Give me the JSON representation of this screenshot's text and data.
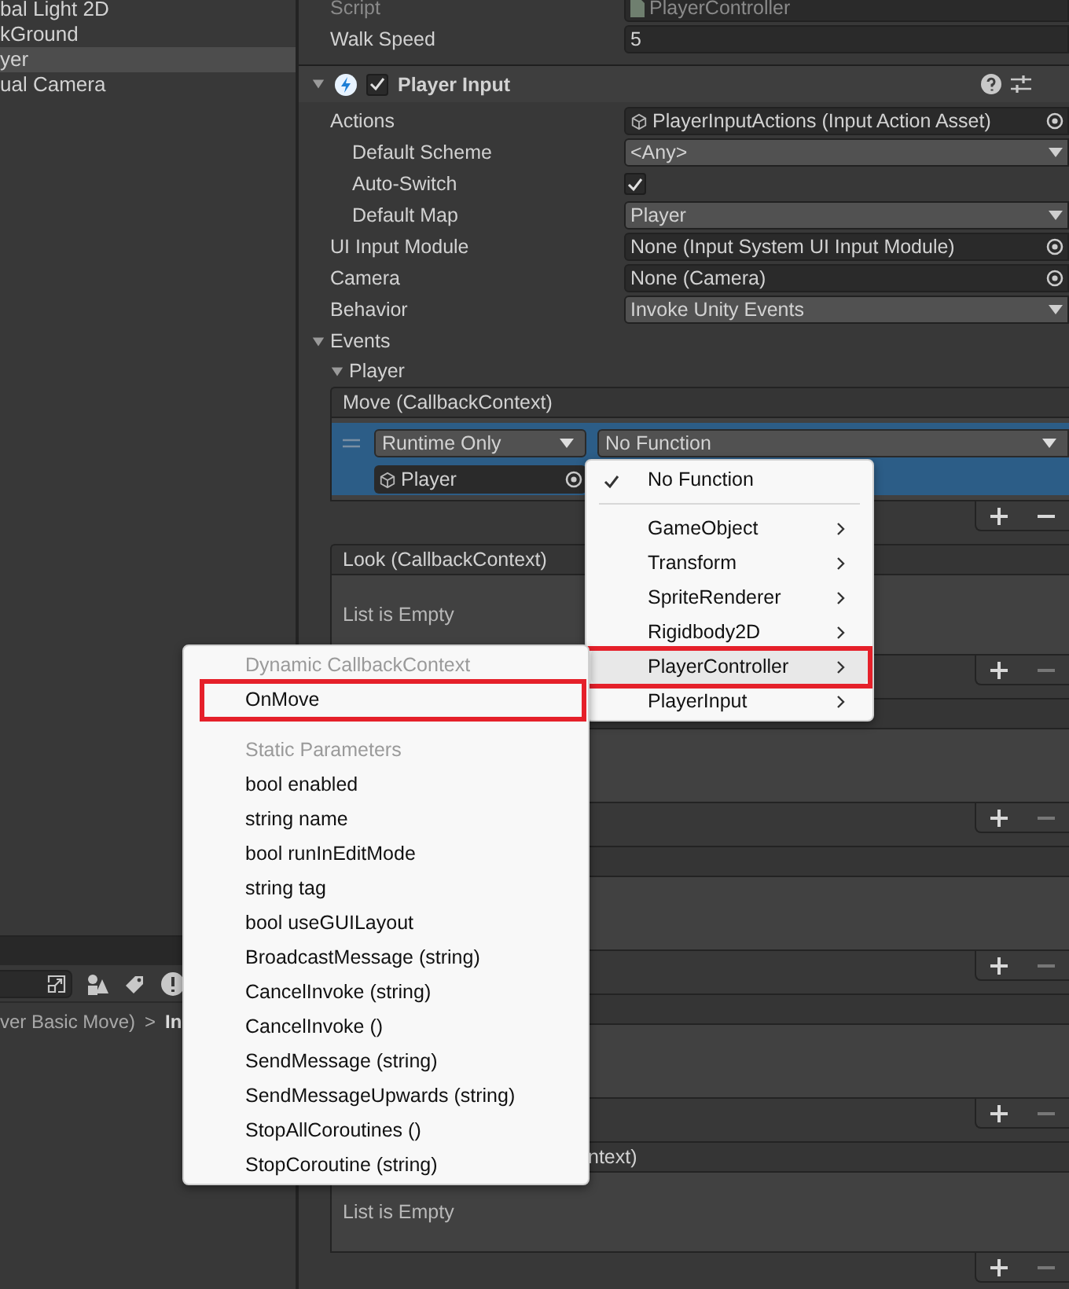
{
  "hierarchy": {
    "items": [
      {
        "label": "bal Light 2D",
        "selected": false
      },
      {
        "label": "kGround",
        "selected": false
      },
      {
        "label": "yer",
        "selected": true
      },
      {
        "label": "ual Camera",
        "selected": false
      }
    ]
  },
  "project": {
    "breadcrumb": [
      {
        "label": "ver Basic Move)",
        "current": false
      },
      {
        "label": "In",
        "current": true
      }
    ],
    "separator": ">"
  },
  "inspector": {
    "script": {
      "label": "Script",
      "value": "PlayerController",
      "disabled": true
    },
    "walk_speed": {
      "label": "Walk Speed",
      "value": "5"
    },
    "component": {
      "title": "Player Input",
      "enabled": true,
      "expanded": true,
      "properties": [
        {
          "label": "Actions",
          "kind": "object",
          "value": "PlayerInputActions (Input Action Asset)",
          "children": [
            {
              "label": "Default Scheme",
              "kind": "dropdown",
              "value": "<Any>"
            },
            {
              "label": "Auto-Switch",
              "kind": "checkbox",
              "checked": true
            },
            {
              "label": "Default Map",
              "kind": "dropdown",
              "value": "Player"
            }
          ]
        },
        {
          "label": "UI Input Module",
          "kind": "object",
          "value": "None (Input System UI Input Module)"
        },
        {
          "label": "Camera",
          "kind": "object",
          "value": "None (Camera)"
        },
        {
          "label": "Behavior",
          "kind": "dropdown",
          "value": "Invoke Unity Events"
        }
      ],
      "events": {
        "label": "Events",
        "expanded": true,
        "maps": [
          {
            "label": "Player",
            "expanded": true,
            "events": [
              {
                "header": "Move (CallbackContext)",
                "can_remove": true,
                "listeners": [
                  {
                    "runtime": "Runtime Only",
                    "function": "No Function",
                    "target": "Player",
                    "selected": true
                  }
                ]
              },
              {
                "header": "Look (CallbackContext)",
                "empty_text": "List is Empty",
                "can_remove": false
              },
              {
                "can_remove": false
              },
              {
                "can_remove": false
              },
              {
                "can_remove": false
              },
              {
                "header": "ntext)",
                "empty_text": "List is Empty",
                "can_remove": false
              }
            ]
          }
        ]
      }
    }
  },
  "function_menu": {
    "items": [
      {
        "kind": "check",
        "label": "No Function",
        "checked": true
      },
      {
        "kind": "separator"
      },
      {
        "kind": "submenu",
        "label": "GameObject",
        "selected": false,
        "annotated": false
      },
      {
        "kind": "submenu",
        "label": "Transform",
        "selected": false,
        "annotated": false
      },
      {
        "kind": "submenu",
        "label": "SpriteRenderer",
        "selected": false,
        "annotated": false
      },
      {
        "kind": "submenu",
        "label": "Rigidbody2D",
        "selected": false,
        "annotated": false
      },
      {
        "kind": "submenu",
        "label": "PlayerController",
        "selected": true,
        "annotated": true
      },
      {
        "kind": "submenu",
        "label": "PlayerInput",
        "selected": false,
        "annotated": false
      }
    ]
  },
  "method_menu": {
    "items": [
      {
        "kind": "heading",
        "label": "Dynamic CallbackContext"
      },
      {
        "kind": "item",
        "label": "OnMove",
        "annotated": true
      },
      {
        "kind": "heading",
        "label": "Static Parameters"
      },
      {
        "kind": "item",
        "label": "bool enabled",
        "annotated": false
      },
      {
        "kind": "item",
        "label": "string name",
        "annotated": false
      },
      {
        "kind": "item",
        "label": "bool runInEditMode",
        "annotated": false
      },
      {
        "kind": "item",
        "label": "string tag",
        "annotated": false
      },
      {
        "kind": "item",
        "label": "bool useGUILayout",
        "annotated": false
      },
      {
        "kind": "item",
        "label": "BroadcastMessage (string)",
        "annotated": false
      },
      {
        "kind": "item",
        "label": "CancelInvoke (string)",
        "annotated": false
      },
      {
        "kind": "item",
        "label": "CancelInvoke ()",
        "annotated": false
      },
      {
        "kind": "item",
        "label": "SendMessage (string)",
        "annotated": false
      },
      {
        "kind": "item",
        "label": "SendMessageUpwards (string)",
        "annotated": false
      },
      {
        "kind": "item",
        "label": "StopAllCoroutines ()",
        "annotated": false
      },
      {
        "kind": "item",
        "label": "StopCoroutine (string)",
        "annotated": false
      }
    ]
  }
}
